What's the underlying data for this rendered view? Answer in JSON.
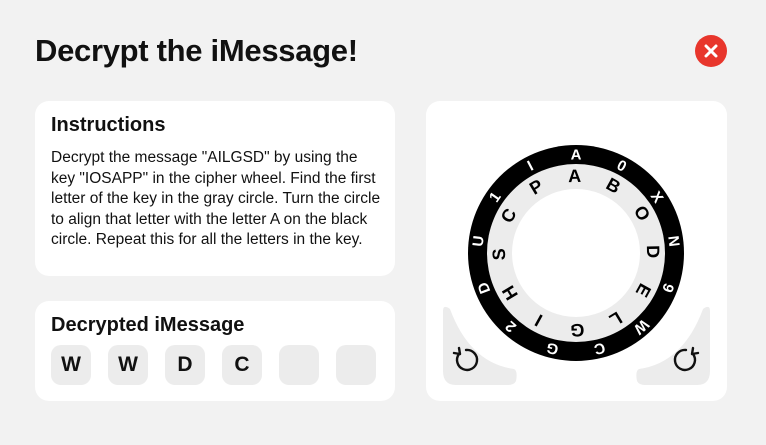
{
  "page": {
    "title": "Decrypt the iMessage!"
  },
  "instructions": {
    "heading": "Instructions",
    "body": "Decrypt the message \"AILGSD\" by using the key \"IOSAPP\" in the cipher wheel. Find the first letter of the key in the gray circle. Turn the circle to align that letter with the letter A on the black circle. Repeat this for all the letters in the key."
  },
  "decrypted": {
    "heading": "Decrypted iMessage",
    "letters": [
      "W",
      "W",
      "D",
      "C",
      "",
      ""
    ]
  },
  "wheel": {
    "outer_letters": [
      "A",
      "0",
      "X",
      "N",
      "9",
      "W",
      "C",
      "G",
      "2",
      "D",
      "U",
      "1",
      "I"
    ],
    "inner_letters": [
      "A",
      "B",
      "O",
      "D",
      "E",
      "L",
      "G",
      "I",
      "H",
      "S",
      "C",
      "P"
    ]
  },
  "icons": {
    "close": "close-icon",
    "rotate_left": "rotate-counterclockwise-icon",
    "rotate_right": "rotate-clockwise-icon"
  },
  "colors": {
    "close_button": "#e8362c",
    "ring": "#000000",
    "background": "#f2f2f2"
  }
}
